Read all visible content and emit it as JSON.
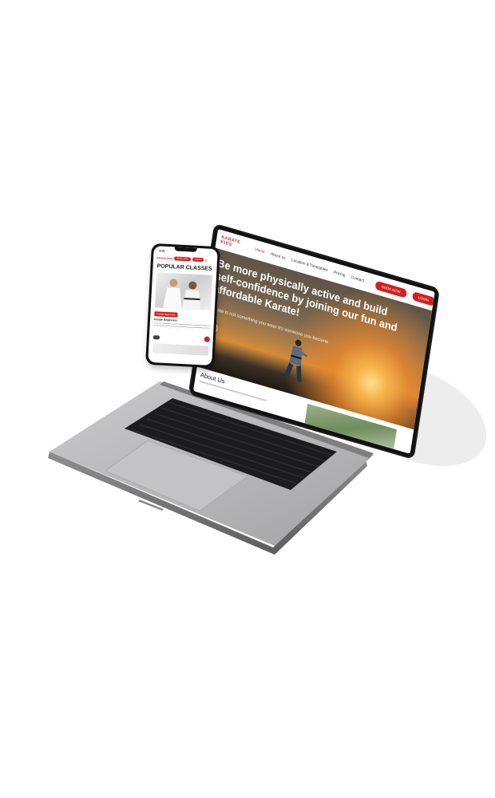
{
  "laptop_site": {
    "logo": "KARATE KIDS",
    "nav": [
      {
        "label": "Home",
        "active": true
      },
      {
        "label": "About us",
        "active": false
      },
      {
        "label": "Location & Timetables",
        "active": false
      },
      {
        "label": "Pricing",
        "active": false
      },
      {
        "label": "Contact",
        "active": false
      }
    ],
    "book_now_label": "BOOK NOW",
    "login_label": "LOGIN",
    "hero_title": "Be more physically active and build self-confidence by joining our fun and affordable Karate!",
    "hero_subtitle": "Karate is not something you wear it's someone you become",
    "about_title": "About Us"
  },
  "phone_site": {
    "time": "9:41",
    "logo": "KARATE KIDS",
    "book_now_label": "BOOK NOW",
    "login_label": "LOGIN",
    "section_title": "POPULAR CLASSES",
    "class_tag": "Karate Beginners",
    "class_name": "Karate Beginners"
  },
  "colors": {
    "brand_red": "#d41f1f",
    "device_black": "#111111",
    "laptop_silver": "#b9b9bb"
  }
}
